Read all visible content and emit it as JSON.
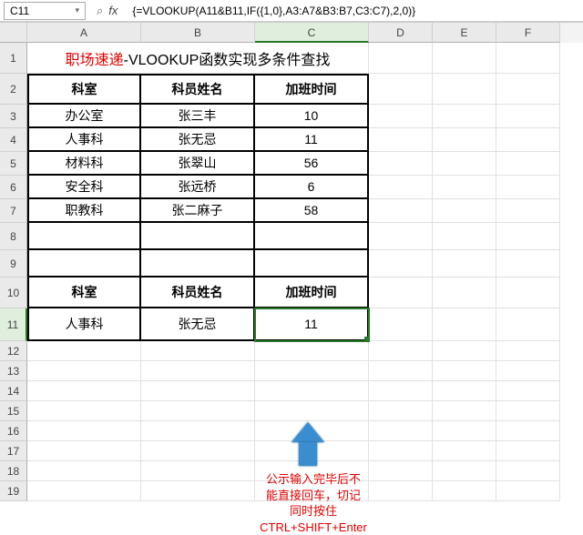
{
  "name_box": "C11",
  "formula": "{=VLOOKUP(A11&B11,IF({1,0},A3:A7&B3:B7,C3:C7),2,0)}",
  "columns": [
    "",
    "A",
    "B",
    "C",
    "D",
    "E",
    "F"
  ],
  "active_col": "C",
  "active_row": "11",
  "rows": [
    "1",
    "2",
    "3",
    "4",
    "5",
    "6",
    "7",
    "8",
    "9",
    "10",
    "11",
    "12",
    "13",
    "14",
    "15",
    "16",
    "17",
    "18",
    "19"
  ],
  "title": {
    "red": "职场速递",
    "sep": "-",
    "black": "VLOOKUP函数实现多条件查找"
  },
  "table1": {
    "headers": {
      "dept": "科室",
      "name": "科员姓名",
      "over": "加班时间"
    },
    "rows": [
      {
        "dept": "办公室",
        "name": "张三丰",
        "over": "10"
      },
      {
        "dept": "人事科",
        "name": "张无忌",
        "over": "11"
      },
      {
        "dept": "材料科",
        "name": "张翠山",
        "over": "56"
      },
      {
        "dept": "安全科",
        "name": "张远桥",
        "over": "6"
      },
      {
        "dept": "职教科",
        "name": "张二麻子",
        "over": "58"
      }
    ]
  },
  "table2": {
    "headers": {
      "dept": "科室",
      "name": "科员姓名",
      "over": "加班时间"
    },
    "row": {
      "dept": "人事科",
      "name": "张无忌",
      "over": "11"
    }
  },
  "annotation": {
    "l1": "公示输入完毕后不",
    "l2": "能直接回车，切记",
    "l3": "同时按住",
    "l4": "CTRL+SHIFT+Enter"
  }
}
